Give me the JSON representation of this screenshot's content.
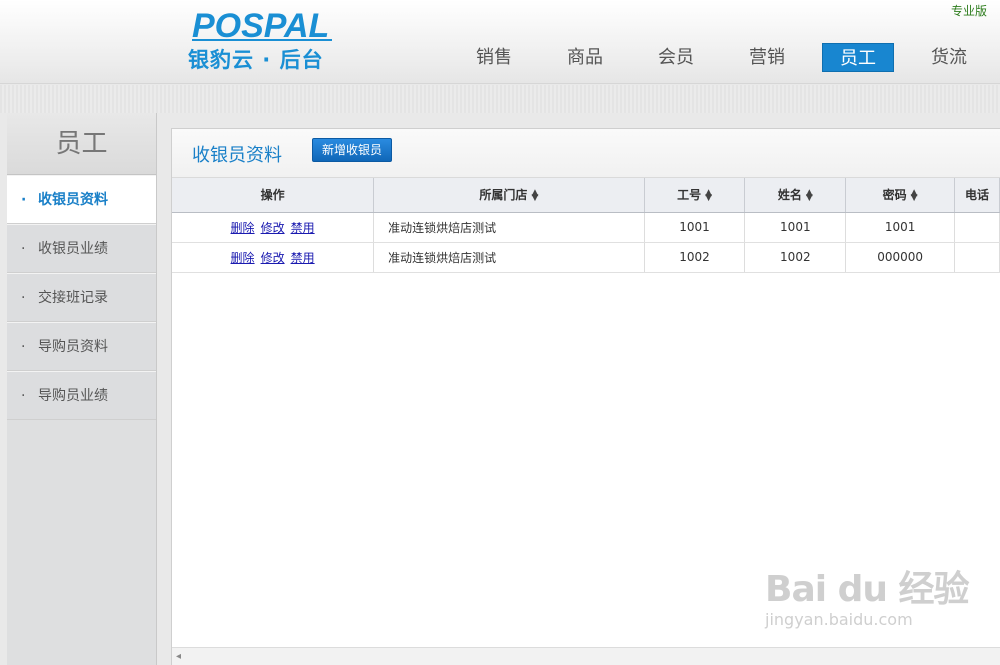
{
  "header": {
    "logo_brand": "POSPAL",
    "logo_text": "银豹云 · 后台",
    "edition": "专业版",
    "nav": [
      "销售",
      "商品",
      "会员",
      "营销",
      "员工",
      "货流"
    ],
    "nav_active": "员工"
  },
  "sidebar": {
    "title": "员工",
    "items": [
      {
        "label": "收银员资料",
        "active": true
      },
      {
        "label": "收银员业绩",
        "active": false
      },
      {
        "label": "交接班记录",
        "active": false
      },
      {
        "label": "导购员资料",
        "active": false
      },
      {
        "label": "导购员业绩",
        "active": false
      }
    ]
  },
  "main": {
    "title": "收银员资料",
    "add_button": "新增收银员",
    "columns": [
      "操作",
      "所属门店",
      "工号",
      "姓名",
      "密码",
      "电话"
    ],
    "ops": [
      "删除",
      "修改",
      "禁用"
    ],
    "rows": [
      {
        "store": "准动连锁烘焙店测试",
        "id": "1001",
        "name": "1001",
        "password": "1001",
        "phone": ""
      },
      {
        "store": "准动连锁烘焙店测试",
        "id": "1002",
        "name": "1002",
        "password": "000000",
        "phone": ""
      }
    ]
  },
  "watermark": {
    "logo": "Bai du 经验",
    "url": "jingyan.baidu.com"
  },
  "colors": {
    "accent": "#1886d0",
    "link": "#1a1ab0",
    "edition": "#2e7d1e"
  }
}
